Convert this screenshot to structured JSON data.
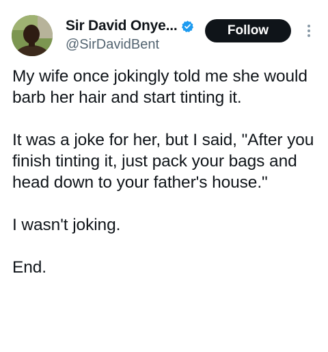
{
  "user": {
    "display_name": "Sir David Onye...",
    "handle": "@SirDavidBent",
    "verified_icon": "verified-badge-icon",
    "avatar_icon": "user-avatar"
  },
  "actions": {
    "follow_label": "Follow",
    "more_icon": "more-vertical-icon"
  },
  "tweet": {
    "paragraphs": [
      "My wife once jokingly told me she would barb her hair and start tinting it.",
      "It was a joke for her, but I said, \"After you finish tinting it, just pack your bags and head down to your father's house.\"",
      "I wasn't joking.",
      "End."
    ]
  },
  "colors": {
    "text": "#0f1419",
    "secondary": "#536471",
    "verified": "#1d9bf0",
    "follow_bg": "#0f1419",
    "follow_text": "#ffffff"
  }
}
